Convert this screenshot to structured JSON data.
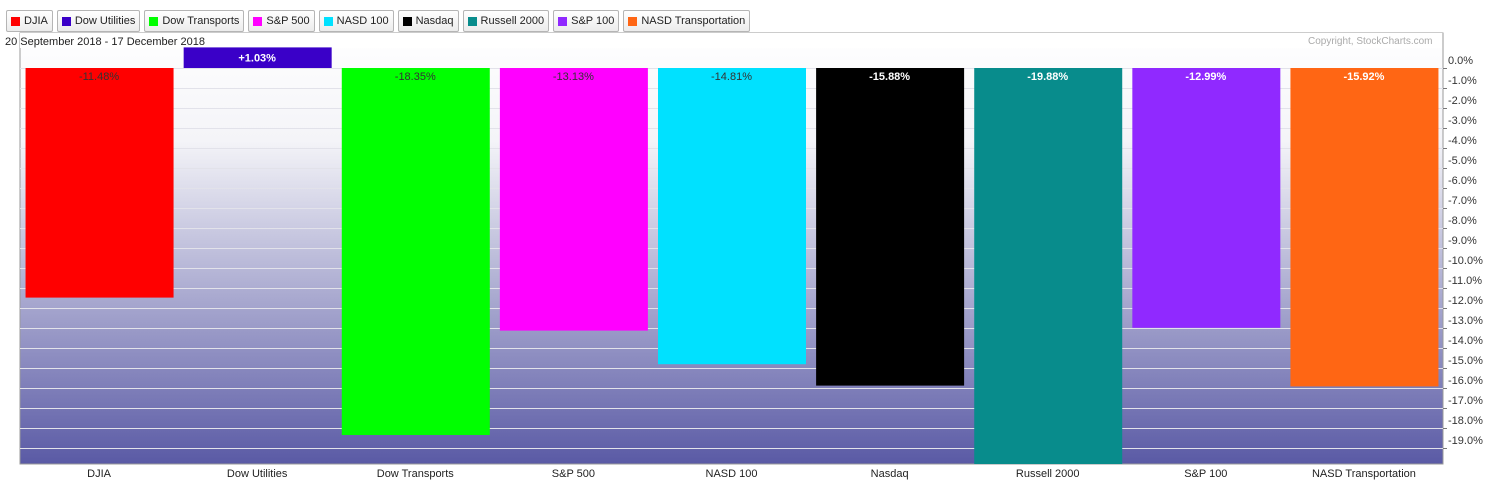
{
  "legend": [
    {
      "label": "DJIA",
      "color": "#ff0000"
    },
    {
      "label": "Dow Utilities",
      "color": "#3a00c8"
    },
    {
      "label": "Dow Transports",
      "color": "#00ff00"
    },
    {
      "label": "S&P 500",
      "color": "#ff00ff"
    },
    {
      "label": "NASD 100",
      "color": "#00e1ff"
    },
    {
      "label": "Nasdaq",
      "color": "#000000"
    },
    {
      "label": "Russell 2000",
      "color": "#088c8c"
    },
    {
      "label": "S&P 100",
      "color": "#9029ff"
    },
    {
      "label": "NASD Transportation",
      "color": "#ff6614"
    }
  ],
  "header": {
    "date_range": "20 September 2018 - 17 December 2018",
    "copyright": "Copyright, StockCharts.com"
  },
  "chart_data": {
    "type": "bar",
    "categories": [
      "DJIA",
      "Dow Utilities",
      "Dow Transports",
      "S&P 500",
      "NASD 100",
      "Nasdaq",
      "Russell 2000",
      "S&P 100",
      "NASD Transportation"
    ],
    "values": [
      -11.48,
      1.03,
      -18.35,
      -13.13,
      -14.81,
      -15.88,
      -19.88,
      -12.99,
      -15.92
    ],
    "value_labels": [
      "-11.48%",
      "+1.03%",
      "-18.35%",
      "-13.13%",
      "-14.81%",
      "-15.88%",
      "-19.88%",
      "-12.99%",
      "-15.92%"
    ],
    "colors": [
      "#ff0000",
      "#3a00c8",
      "#00ff00",
      "#ff00ff",
      "#00e1ff",
      "#000000",
      "#088c8c",
      "#9029ff",
      "#ff6614"
    ],
    "label_colors": [
      "#333333",
      "#ffffff",
      "#333333",
      "#333333",
      "#333333",
      "#ffffff",
      "#ffffff",
      "#ffffff",
      "#ffffff"
    ],
    "yticks": [
      0,
      -1,
      -2,
      -3,
      -4,
      -5,
      -6,
      -7,
      -8,
      -9,
      -10,
      -11,
      -12,
      -13,
      -14,
      -15,
      -16,
      -17,
      -18,
      -19
    ],
    "ytick_labels": [
      "0.0%",
      "-1.0%",
      "-2.0%",
      "-3.0%",
      "-4.0%",
      "-5.0%",
      "-6.0%",
      "-7.0%",
      "-8.0%",
      "-9.0%",
      "-10.0%",
      "-11.0%",
      "-12.0%",
      "-13.0%",
      "-14.0%",
      "-15.0%",
      "-16.0%",
      "-17.0%",
      "-18.0%",
      "-19.0%"
    ],
    "ylim": [
      -19.9,
      1.03
    ],
    "grid": true
  }
}
